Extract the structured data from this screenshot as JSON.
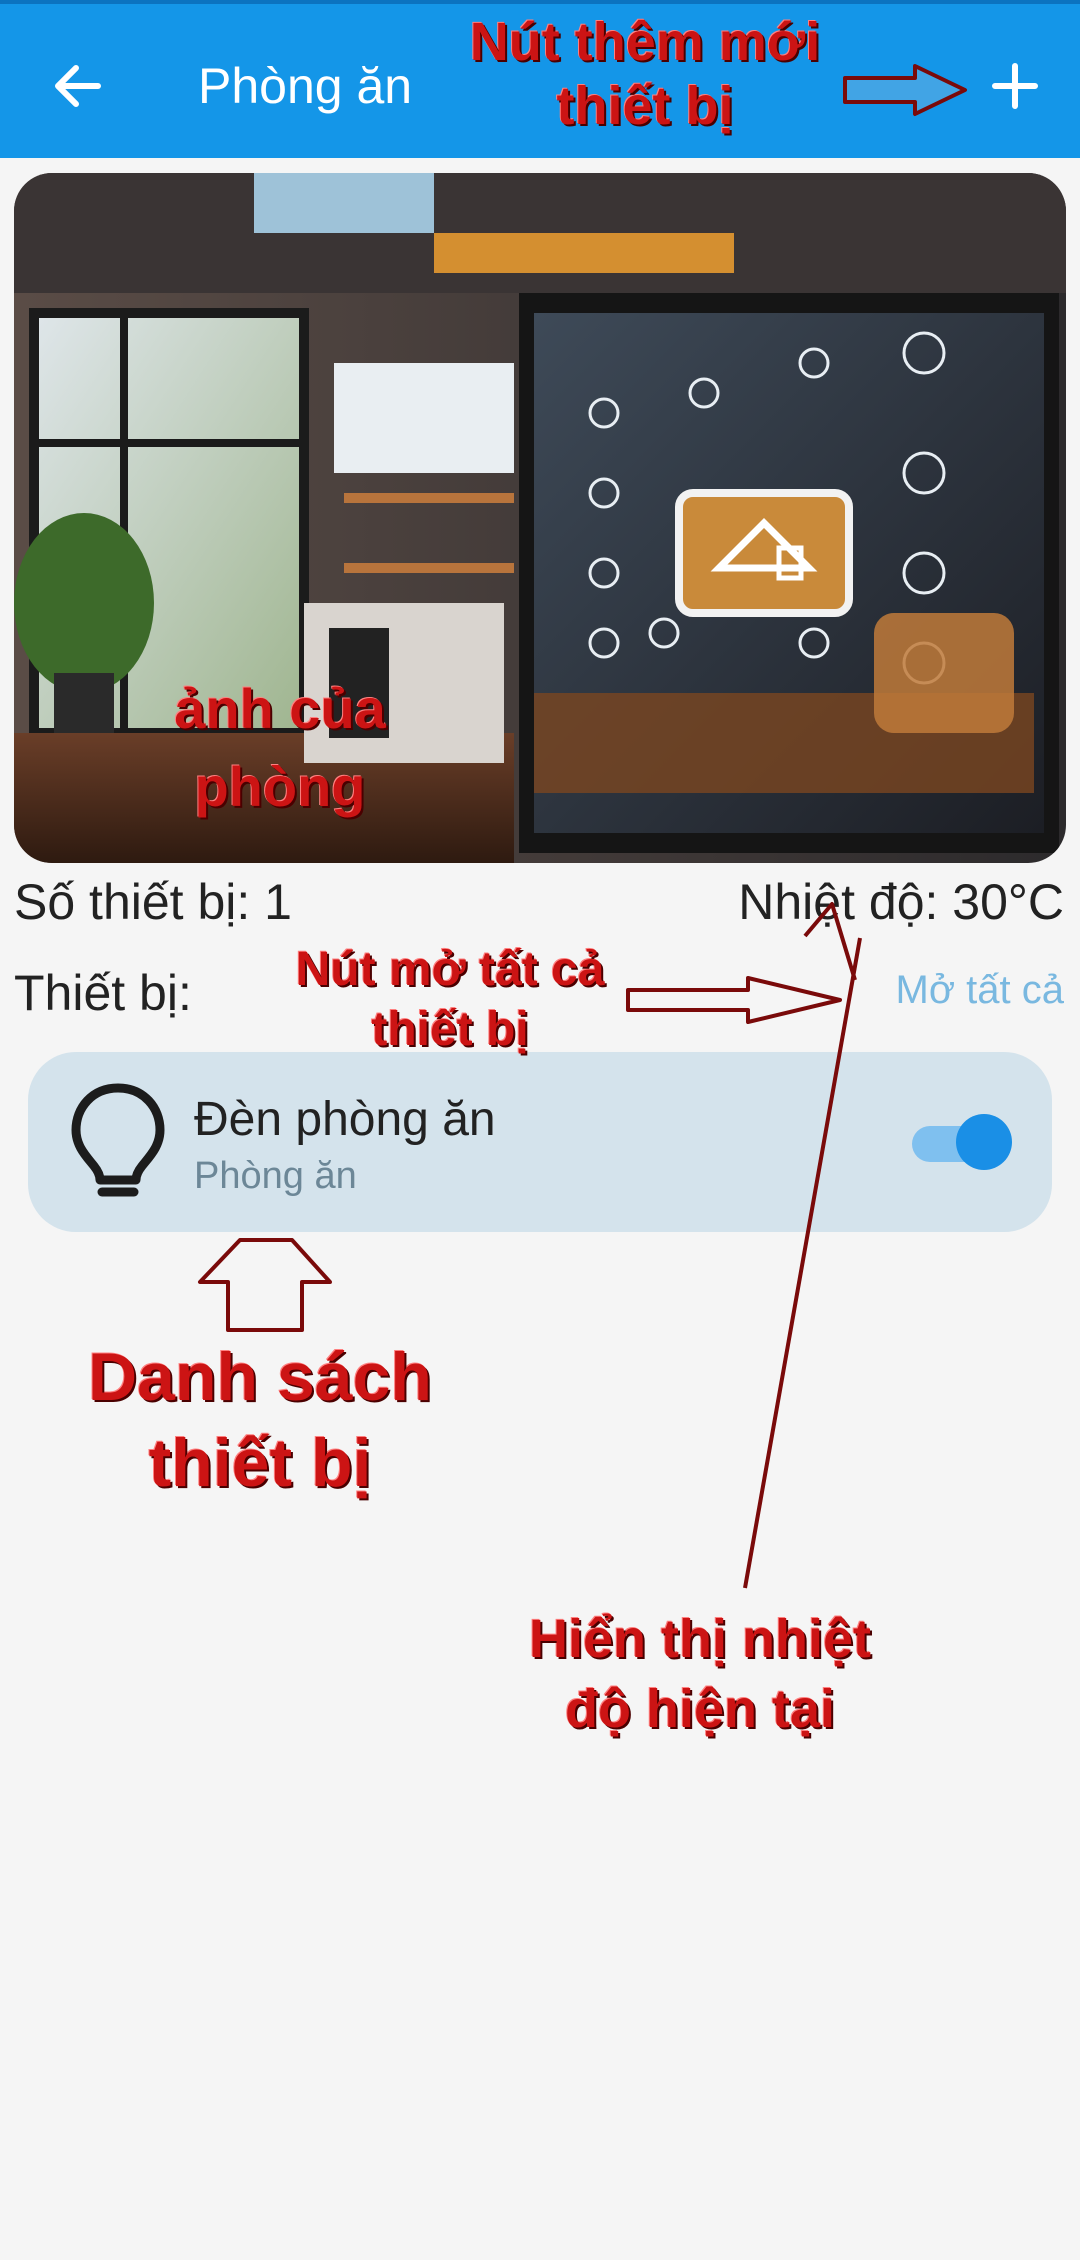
{
  "appbar": {
    "title": "Phòng ăn",
    "back_icon": "arrow-left-icon",
    "add_icon": "plus-icon",
    "background": "#1496e8"
  },
  "room": {
    "device_count_text": "Số thiết bị: 1",
    "temperature_text": "Nhiệt độ: 30°C",
    "devices_label": "Thiết bị:",
    "open_all_label": "Mở tất cả"
  },
  "devices": [
    {
      "name": "Đèn phòng ăn",
      "room": "Phòng ăn",
      "icon": "lightbulb-icon",
      "on": true
    }
  ],
  "annotations": {
    "add_device": [
      "Nút thêm mới",
      "thiết bị"
    ],
    "room_photo": [
      "ảnh của",
      "phòng"
    ],
    "open_all": [
      "Nút mở tất cả",
      "thiết bị"
    ],
    "device_list": [
      "Danh sách",
      "thiết bị"
    ],
    "temperature": [
      "Hiển thị nhiệt",
      "độ hiện tại"
    ]
  },
  "colors": {
    "annotation": "#cc1414",
    "accent": "#1a8fe6",
    "card": "#d4e3ec"
  }
}
